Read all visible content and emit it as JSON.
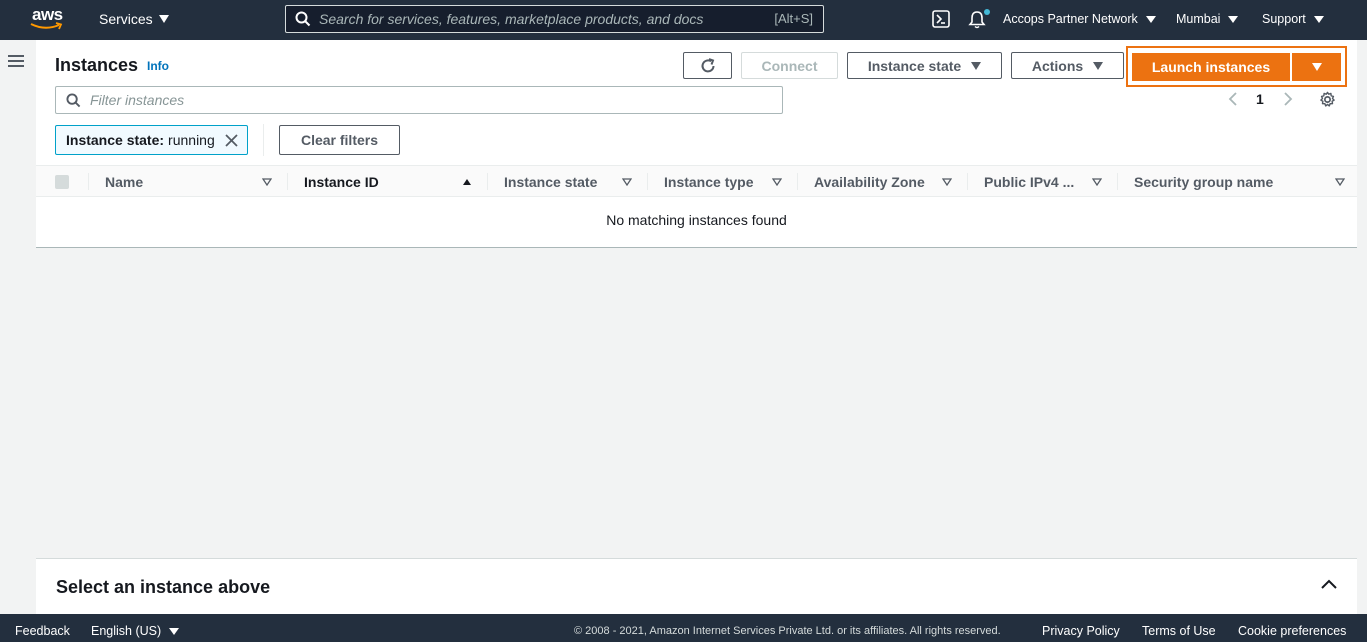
{
  "topnav": {
    "logo_text": "aws",
    "services_label": "Services",
    "search_placeholder": "Search for services, features, marketplace products, and docs",
    "search_shortcut": "[Alt+S]",
    "account_label": "Accops Partner Network",
    "region_label": "Mumbai",
    "support_label": "Support"
  },
  "header": {
    "title": "Instances",
    "info_link": "Info",
    "connect_label": "Connect",
    "instance_state_label": "Instance state",
    "actions_label": "Actions",
    "launch_label": "Launch instances"
  },
  "filter": {
    "placeholder": "Filter instances",
    "token_key": "Instance state:",
    "token_value": "running",
    "clear_label": "Clear filters"
  },
  "pagination": {
    "current_page": "1"
  },
  "table": {
    "columns": [
      "Name",
      "Instance ID",
      "Instance state",
      "Instance type",
      "Availability Zone",
      "Public IPv4 ...",
      "Security group name"
    ],
    "empty_message": "No matching instances found"
  },
  "split_panel": {
    "title": "Select an instance above"
  },
  "footer": {
    "feedback": "Feedback",
    "language": "English (US)",
    "copyright": "© 2008 - 2021, Amazon Internet Services Private Ltd. or its affiliates. All rights reserved.",
    "privacy": "Privacy Policy",
    "terms": "Terms of Use",
    "cookies": "Cookie preferences"
  },
  "colors": {
    "nav_bg": "#232f3e",
    "accent": "#ec7211",
    "link": "#0073bb"
  }
}
